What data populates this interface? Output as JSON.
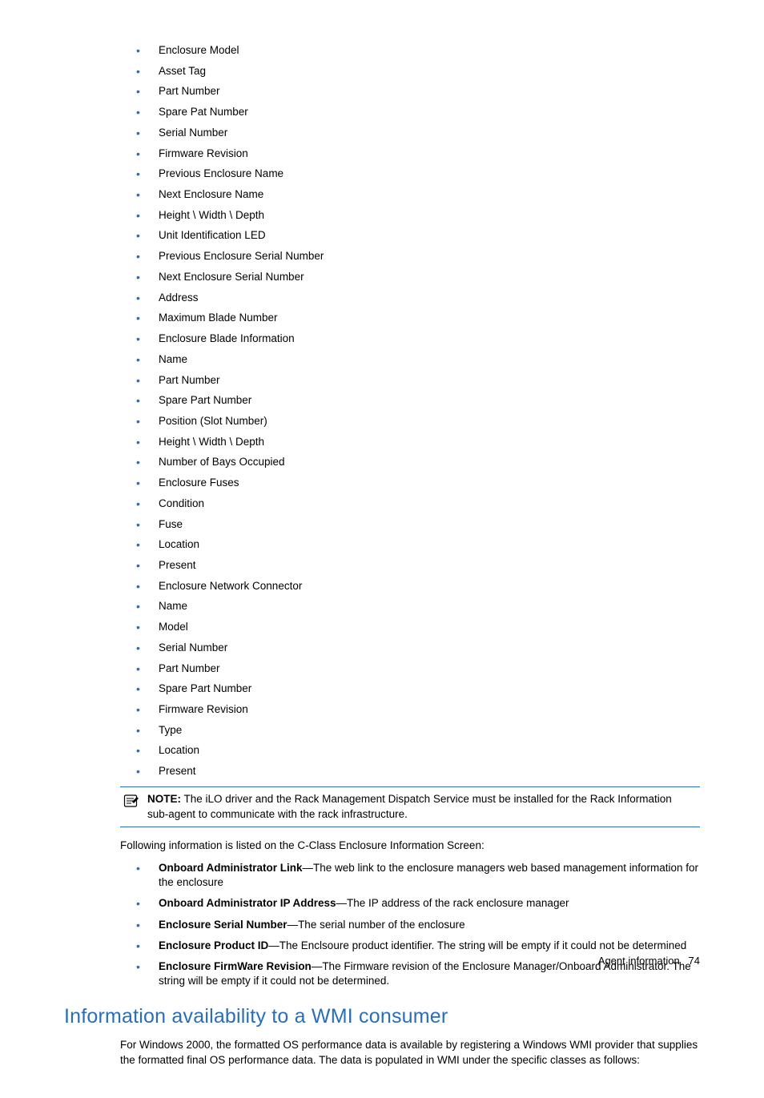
{
  "bullets": [
    "Enclosure Model",
    "Asset Tag",
    "Part Number",
    "Spare Pat Number",
    "Serial Number",
    "Firmware Revision",
    "Previous Enclosure Name",
    "Next Enclosure Name",
    "Height \\ Width \\ Depth",
    "Unit Identification LED",
    "Previous Enclosure Serial Number",
    "Next Enclosure Serial Number",
    "Address",
    "Maximum Blade Number",
    "Enclosure Blade Information",
    "Name",
    "Part Number",
    "Spare Part Number",
    "Position (Slot Number)",
    "Height \\ Width \\ Depth",
    "Number of Bays Occupied",
    "Enclosure Fuses",
    "Condition",
    "Fuse",
    "Location",
    "Present",
    "Enclosure Network Connector",
    "Name",
    "Model",
    "Serial Number",
    "Part Number",
    "Spare Part Number",
    "Firmware Revision",
    "Type",
    "Location",
    "Present"
  ],
  "note": {
    "label": "NOTE:",
    "text": "The iLO driver and the Rack Management Dispatch Service must be installed for the Rack Information sub-agent to communicate with the rack infrastructure."
  },
  "followingPara": "Following information is listed on the C-Class Enclosure Information Screen:",
  "defs": [
    {
      "term": "Onboard Administrator Link",
      "desc": "—The web link to the enclosure managers web based management information for the enclosure"
    },
    {
      "term": "Onboard Administrator IP Address",
      "desc": "—The IP address of the rack enclosure manager"
    },
    {
      "term": "Enclosure Serial Number",
      "desc": "—The serial number of the enclosure"
    },
    {
      "term": "Enclosure Product ID",
      "desc": "—The Enclsoure product identifier. The string will be empty if it could not be determined"
    },
    {
      "term": "Enclosure FirmWare Revision",
      "desc": "—The Firmware revision of the Enclosure Manager/Onboard Administrator. The string will be empty if it could not be determined."
    }
  ],
  "sectionHeading": "Information availability to a WMI consumer",
  "sectionPara": "For Windows 2000, the formatted OS performance data is available by registering a Windows WMI provider that supplies the formatted final OS performance data. The data is populated in WMI under the specific classes as follows:",
  "footer": {
    "label": "Agent information",
    "page": "74"
  }
}
